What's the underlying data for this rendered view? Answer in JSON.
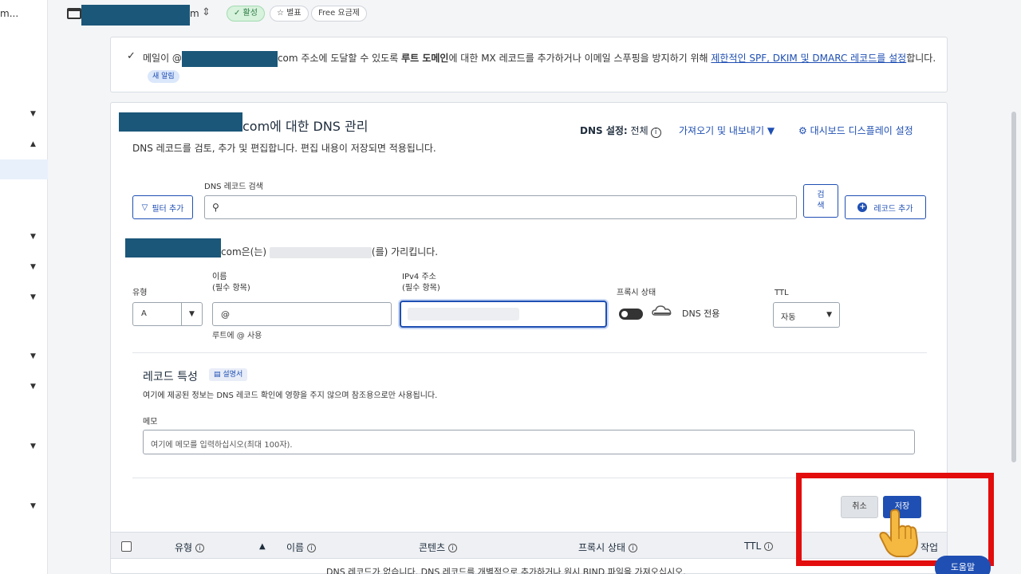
{
  "sidebar": {
    "brand": "m..."
  },
  "topbar": {
    "domain_suffix": "m",
    "badges": {
      "active": "✓ 활성",
      "star": "☆ 별표",
      "plan": "Free 요금제"
    }
  },
  "alert": {
    "prefix": "메일이 @",
    "suffix_domain": "com",
    "body1": " 주소에 도달할 수 있도록 ",
    "bold": "루트 도메인",
    "body2": "에 대한 MX 레코드를 추가하거나 이메일 스푸핑을 방지하기 위해 ",
    "link": "제한적인 SPF, DKIM 및 DMARC 레코드를 설정",
    "end": "합니다.",
    "new_badge": "새 알림"
  },
  "dns": {
    "title": "com에 대한 DNS 관리",
    "description": "DNS 레코드를 검토, 추가 및 편집합니다. 편집 내용이 저장되면 적용됩니다.",
    "setting_label": "DNS 설정:",
    "setting_value": "전체",
    "import_export": "가져오기 및 내보내기",
    "dashboard_display": "대시보드 디스플레이 설정",
    "search_label": "DNS 레코드 검색",
    "filter_btn": "필터 추가",
    "search_btn_line1": "검",
    "search_btn_line2": "색",
    "add_record_btn": "레코드 추가"
  },
  "points": {
    "prefix": "com은(는) ",
    "suffix": "(를) 가리킵니다."
  },
  "form": {
    "type_label": "유형",
    "type_value": "A",
    "name_label": "이름",
    "name_required": "(필수 항목)",
    "name_value": "@",
    "name_help": "루트에 @ 사용",
    "ipv4_label": "IPv4 주소",
    "ipv4_required": "(필수 항목)",
    "proxy_label": "프록시 상태",
    "proxy_value": "DNS 전용",
    "ttl_label": "TTL",
    "ttl_value": "자동"
  },
  "record_attrs": {
    "title": "레코드 특성",
    "doc_badge": "설명서",
    "description": "여기에 제공된 정보는 DNS 레코드 확인에 영향을 주지 않으며 참조용으로만 사용됩니다.",
    "memo_label": "메모",
    "memo_placeholder": "여기에 메모를 입력하십시오(최대 100자)."
  },
  "actions": {
    "cancel": "취소",
    "save": "저장"
  },
  "table": {
    "headers": {
      "type": "유형",
      "name": "이름",
      "content": "콘텐츠",
      "proxy": "프록시 상태",
      "ttl": "TTL",
      "actions": "작업"
    },
    "empty": "DNS 레코드가 없습니다. DNS 레코드를 개별적으로 추가하거나 원시 BIND 파일을 가져오십시오."
  },
  "help_btn": "도움말",
  "colors": {
    "accent": "#1f4fb3",
    "redaction": "#1b5779",
    "highlight": "#e30d0d",
    "active_badge": "#d7f2dd"
  }
}
